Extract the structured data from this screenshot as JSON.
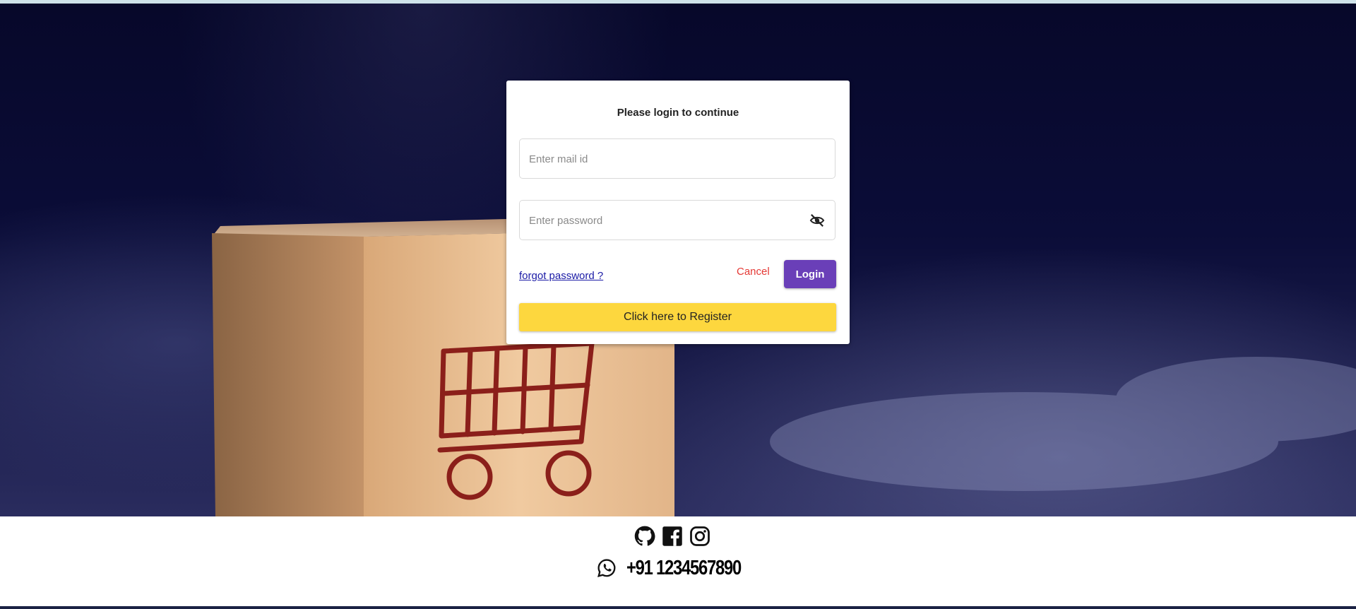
{
  "login_card": {
    "title": "Please login to continue",
    "email_placeholder": "Enter mail id",
    "email_value": "",
    "password_placeholder": "Enter password",
    "password_value": "",
    "forgot_label": "forgot password ?",
    "cancel_label": "Cancel",
    "login_label": "Login",
    "register_label": "Click here to Register"
  },
  "footer": {
    "social_icons": [
      "github-icon",
      "facebook-icon",
      "instagram-icon"
    ],
    "whatsapp_icon": "whatsapp-icon",
    "phone": "+91 1234567890"
  },
  "colors": {
    "login_button": "#6a3fb8",
    "register_button": "#fdd73e",
    "cancel_text": "#e53935",
    "link": "#1a1aa6"
  }
}
